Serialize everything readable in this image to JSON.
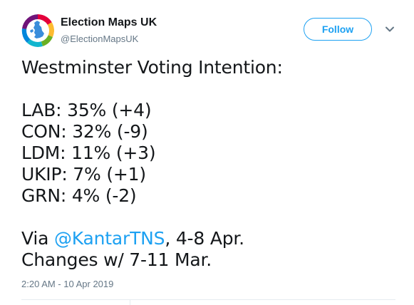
{
  "account": {
    "name": "Election Maps UK",
    "handle": "@ElectionMapsUK",
    "avatar_icon": "uk-map-logo-icon"
  },
  "actions": {
    "follow_label": "Follow",
    "more_icon": "chevron-down-icon"
  },
  "tweet": {
    "heading": "Westminster Voting Intention:",
    "results": [
      "LAB: 35% (+4)",
      "CON: 32% (-9)",
      "LDM: 11% (+3)",
      "UKIP: 7% (+1)",
      "GRN: 4% (-2)"
    ],
    "via_prefix": "Via ",
    "mention": "@KantarTNS",
    "via_suffix": ", 4-8 Apr.",
    "changes_note": "Changes w/ 7-11 Mar."
  },
  "meta": {
    "timestamp": "2:20 AM - 10 Apr 2019"
  },
  "colors": {
    "accent": "#1da1f2",
    "text": "#14171a",
    "muted": "#657786",
    "divider": "#e6ecf0"
  }
}
